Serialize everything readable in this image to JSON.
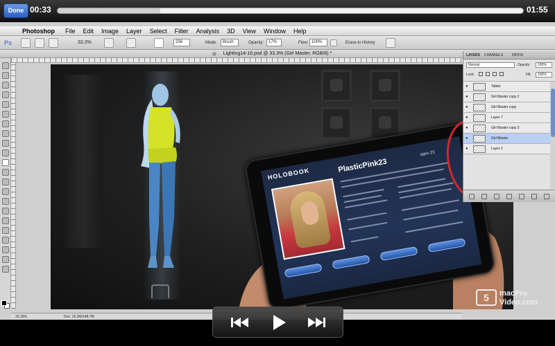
{
  "player": {
    "done_label": "Done",
    "elapsed": "00:33",
    "remaining": "01:55",
    "progress": 0.22,
    "controls": [
      "rewind-icon",
      "play-icon",
      "fast-forward-icon"
    ]
  },
  "mac": {
    "app_name": "Photoshop",
    "menus": [
      "File",
      "Edit",
      "Image",
      "Layer",
      "Select",
      "Filter",
      "Analysis",
      "3D",
      "View",
      "Window",
      "Help"
    ]
  },
  "options": {
    "zoom": "33.3%",
    "brush_size": "256",
    "mode_label": "Mode:",
    "mode_value": "Brush",
    "opacity_label": "Opacity:",
    "opacity_value": "17%",
    "flow_label": "Flow:",
    "flow_value": "100%",
    "erase_history": "Erase to History"
  },
  "document": {
    "title": "Lighting14-16.psd @ 33.3% (Girl Master, RGB/8) *"
  },
  "layers_panel": {
    "tabs": [
      "LAYERS",
      "CHANNELS",
      "PATHS"
    ],
    "blend_mode": "Normal",
    "opacity_label": "Opacity:",
    "opacity_value": "100%",
    "lock_label": "Lock:",
    "fill_label": "Fill:",
    "fill_value": "100%",
    "layers": [
      {
        "name": "Tablet",
        "selected": false
      },
      {
        "name": "Girl Master copy 2",
        "selected": false
      },
      {
        "name": "Girl Master copy",
        "selected": false
      },
      {
        "name": "Layer 7",
        "selected": false
      },
      {
        "name": "Girl Master copy 3",
        "selected": false
      },
      {
        "name": "Girl Master",
        "selected": true
      },
      {
        "name": "Layer 2",
        "selected": false
      }
    ]
  },
  "status": {
    "zoom": "33.33%",
    "doc": "Doc: 16.2M/148.7M"
  },
  "tablet_app": {
    "logo": "HOLOBOOK",
    "name": "PlasticPink23",
    "age": "ages 23"
  },
  "watermark": {
    "line1": "macPro",
    "line2": "Video.com"
  },
  "colors": {
    "accent": "#2c5fc4",
    "annotation": "#d7272c"
  }
}
